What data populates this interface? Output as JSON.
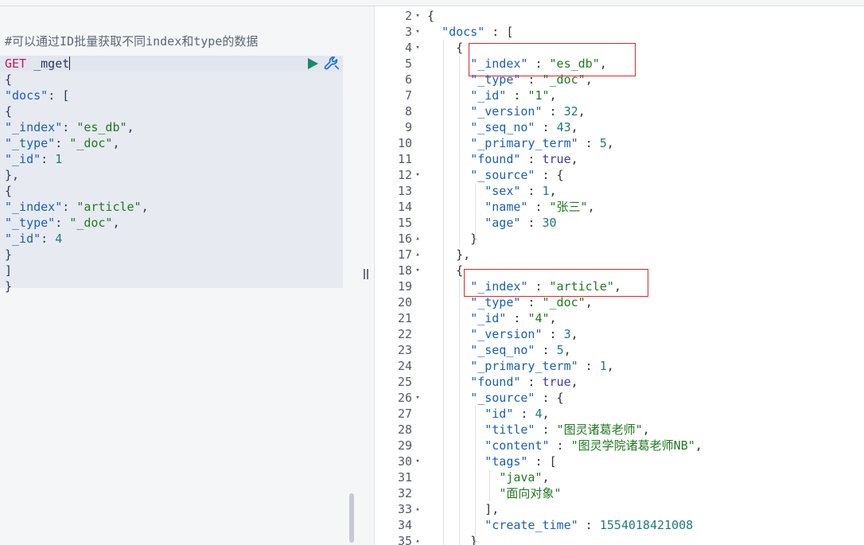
{
  "request": {
    "comment": "#可以通过ID批量获取不同index和type的数据",
    "method": "GET",
    "path": "_mget",
    "body": [
      "{",
      "\"docs\": [",
      "{",
      "\"_index\": \"es_db\",",
      "\"_type\": \"_doc\",",
      "\"_id\": 1",
      "},",
      "{",
      "\"_index\": \"article\",",
      "\"_type\": \"_doc\",",
      "\"_id\": 4",
      "}",
      "]",
      "}"
    ],
    "run_icon": "play-icon",
    "settings_icon": "wrench-icon"
  },
  "response": {
    "line_numbers": [
      "2",
      "3",
      "4",
      "5",
      "6",
      "7",
      "8",
      "9",
      "10",
      "11",
      "12",
      "13",
      "14",
      "15",
      "16",
      "17",
      "18",
      "19",
      "20",
      "21",
      "22",
      "23",
      "24",
      "25",
      "26",
      "27",
      "28",
      "29",
      "30",
      "31",
      "32",
      "33",
      "34",
      "35"
    ],
    "lines": [
      "{",
      "  \"docs\" : [",
      "    {",
      "      \"_index\" : \"es_db\",",
      "      \"_type\" : \"_doc\",",
      "      \"_id\" : \"1\",",
      "      \"_version\" : 32,",
      "      \"_seq_no\" : 43,",
      "      \"_primary_term\" : 5,",
      "      \"found\" : true,",
      "      \"_source\" : {",
      "        \"sex\" : 1,",
      "        \"name\" : \"张三\",",
      "        \"age\" : 30",
      "      }",
      "    },",
      "    {",
      "      \"_index\" : \"article\",",
      "      \"_type\" : \"_doc\",",
      "      \"_id\" : \"4\",",
      "      \"_version\" : 3,",
      "      \"_seq_no\" : 5,",
      "      \"_primary_term\" : 1,",
      "      \"found\" : true,",
      "      \"_source\" : {",
      "        \"id\" : 4,",
      "        \"title\" : \"图灵诸葛老师\",",
      "        \"content\" : \"图灵学院诸葛老师NB\",",
      "        \"tags\" : [",
      "          \"java\",",
      "          \"面向对象\"",
      "        ],",
      "        \"create_time\" : 1554018421008",
      "      }"
    ],
    "fold_markers": {
      "2": "▾",
      "3": "▾",
      "4": "▾",
      "12": "▾",
      "16": "▴",
      "17": "▴",
      "18": "▾",
      "26": "▾",
      "30": "▾",
      "33": "▴",
      "35": "▴"
    },
    "highlight_color": "#e0262b"
  },
  "colors": {
    "method": "#c2185b",
    "string": "#1f7a1f",
    "key": "#1a5fb4",
    "number": "#1f7a7a",
    "boolean": "#3a3aa8",
    "run_button": "#178a6b",
    "wrench": "#1a6fd1"
  }
}
